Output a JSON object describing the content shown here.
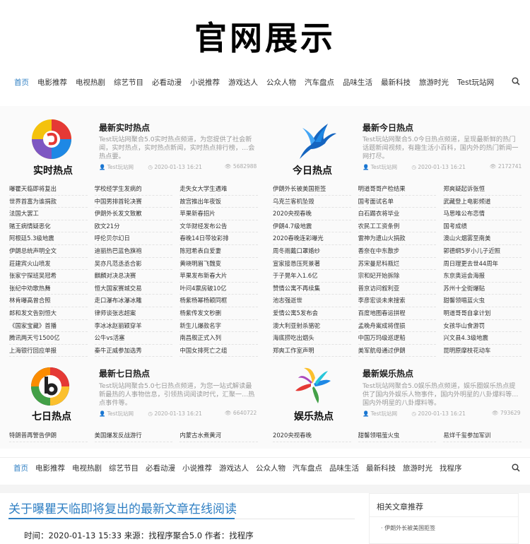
{
  "site": {
    "logo": "官网展示"
  },
  "nav_top": {
    "items": [
      "首页",
      "电影推荐",
      "电视热剧",
      "综艺节目",
      "必看动漫",
      "小说推荐",
      "游戏达人",
      "公众人物",
      "汽车盘点",
      "品味生活",
      "最新科技",
      "旅游时光",
      "Test玩站网"
    ],
    "active_index": 0
  },
  "nav_bottom": {
    "items": [
      "首页",
      "电影推荐",
      "电视热剧",
      "综艺节目",
      "必看动漫",
      "小说推荐",
      "游戏达人",
      "公众人物",
      "汽车盘点",
      "品味生活",
      "最新科技",
      "旅游时光",
      "找程序"
    ],
    "active_index": 0
  },
  "colors": {
    "accent": "#2f7fc3"
  },
  "blocks": [
    {
      "icon_label": "实时热点",
      "icon": "realtime-hot-icon",
      "title": "最新实时热点",
      "desc": "Test玩站网聚合5.0实时热点频道，为您提供了社会新闻，实时热点，实时热点新闻，实时热点排行榜，…会热点要。",
      "author": "Test玩站网",
      "date": "2020-01-13 16:21",
      "views": "5682988",
      "list": [
        "曝瞿天临即将复出",
        "学校经学生发病的",
        "走失女大学生遇难",
        "世界首富为谁捐款",
        "中国男排首轮决赛",
        "故宫推出年夜饭",
        "法国大罢工",
        "伊朗外长发文致歉",
        "苹果新春招片",
        "赌王病情疑恶化",
        "欧文21分",
        "文华财经发布公告",
        "阿根廷5.3级地震",
        "呼伦贝尔幻日",
        "春晚14日带妆彩排",
        "伊朗总统声明全文",
        "迪丽热巴蓝色旗袍",
        "陈冠希表白爱妻",
        "莊建宾火山喷发",
        "吴亦凡范丞丞合影",
        "黄晓明眉飞魏变",
        "张家宁探班吴冠希",
        "麒麟对决总决赛",
        "苹果发布新春大片",
        "张纪中劝歌热舞",
        "恒大国家赛城交易",
        "叶问4票房破10亿",
        "林肯曝高曾合照",
        "走口瀑布冰瀑冰雕",
        "杨紫杨幂杨颖同框",
        "郎和发文告别恒大",
        "律师谈张志超案",
        "杨紫传发文秒删",
        "《国家宝藏》首播",
        "李冰冰赵丽颖穿羊",
        "新生儿爆款名字",
        "腾讯两天亏1500亿",
        "公牛vs活塞",
        "南昌舰正式入列",
        "上海银行回应单报",
        "秦牛正威参加选秀",
        "中国女排死亡之组"
      ]
    },
    {
      "icon_label": "今日热点",
      "icon": "today-hot-bird-icon",
      "title": "最新今日热点",
      "desc": "Test玩站网聚合5.0今日热点频道，呈现最新鲜的热门话题新闻视频，有趣生活小百科，国内外的热门新闻一网打尽。",
      "author": "Test玩站网",
      "date": "2020-01-13 16:21",
      "views": "2172741",
      "list": [
        "伊朗外长被美国拒签",
        "明道哥哥产检结果",
        "郑爽疑起诉张恒",
        "乌克兰客机坠毁",
        "国考面试名单",
        "武藏登上电影频道",
        "2020央视春晚",
        "白石踢衣将毕业",
        "马思唯公布恋情",
        "伊朗4.7级地震",
        "农民工工资条例",
        "国考成绩",
        "2020春晚连彩曝光",
        "雷神为遗山火捐款",
        "澳山火烟雾至南美",
        "周冬雨戴口罩婚纱",
        "香奈在中东散步",
        "郭德纲5岁小儿子近照",
        "宣家接恳压死景著",
        "苏宋曼尼科瓶烂",
        "周日理更去世44周年",
        "于子晃年入1.6亿",
        "宗和妃开始拆除",
        "东京奥运会海报",
        "赞情公寓不再续集",
        "普京访问叙利亚",
        "苏州十全街爆贴",
        "池志强逝世",
        "李彦宏谈未来搜索",
        "甜馨领唱蓝火虫",
        "爱情公寓5发布会",
        "百度地图春运拼程",
        "明道哥哥自拿计划",
        "澳大利亚射杀骆驼",
        "孟晚舟案成将侄损",
        "女孩华山食游罚",
        "海底捞吃出烟头",
        "中国万玛级巡逻船",
        "兴文县4.3级地震",
        "郑爽工作室声明",
        "美军航母通过伊朗",
        "昆明原摩枝花动车"
      ]
    },
    {
      "icon_label": "七日热点",
      "icon": "seven-day-hot-icon",
      "title": "最新七日热点",
      "desc": "Test玩站网聚合5.0七日热点频道，为您一站式解读最新最热的人事物信息，引领热词阅读时代，汇聚一…热点事件等。",
      "author": "Test玩站网",
      "date": "2020-01-13 16:21",
      "views": "6640722",
      "list": [
        "特朗普再警告伊朗",
        "美国爆发反战游行",
        "内蒙古水煮黄河"
      ]
    },
    {
      "icon_label": "娱乐热点",
      "icon": "entertainment-hot-icon",
      "title": "最新娱乐热点",
      "desc": "Test玩站网聚合5.0娱乐热点频道，娱乐圈娱乐热点提供了国内外娱乐人物事件，国内外明星的八卦爆料等…国内外明星的八卦爆料等。",
      "author": "Test玩站网",
      "date": "2020-01-13 16:21",
      "views": "793629",
      "list": [
        "2020央视春晚",
        "甜馨领唱萤火虫",
        "易烊千玺参加军训"
      ]
    }
  ],
  "article": {
    "title": "关于曝瞿天临即将复出的最新文章在线阅读",
    "meta": "时间：2020-01-13 15:33 来源：找程序聚合5.0 作者：找程序"
  },
  "sidebar": {
    "title": "相关文章推荐",
    "items": [
      "伊朗外长被美国拒签"
    ]
  }
}
